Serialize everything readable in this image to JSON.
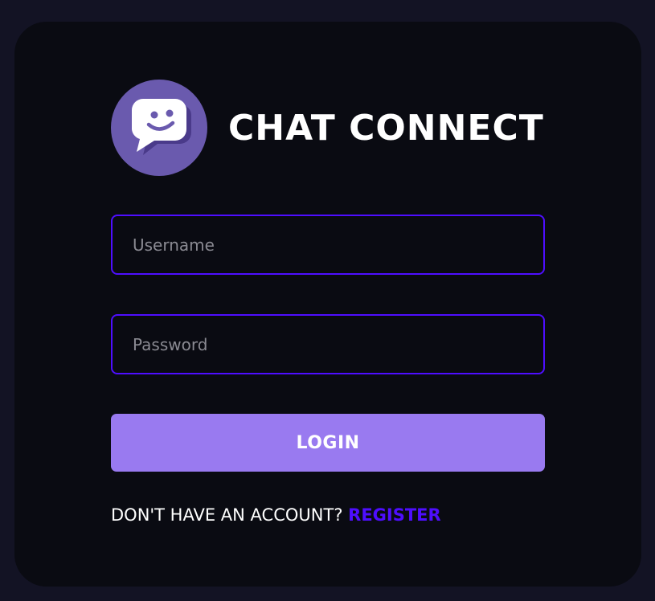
{
  "brand": {
    "title": "CHAT CONNECT",
    "logo_icon": "smiley-chat-bubble-icon",
    "logo_color": "#6a5aae"
  },
  "form": {
    "username_placeholder": "Username",
    "username_value": "",
    "password_placeholder": "Password",
    "password_value": "",
    "login_label": "LOGIN"
  },
  "footer": {
    "prompt": "DON'T HAVE AN ACCOUNT?",
    "register_label": "REGISTER"
  },
  "colors": {
    "page_background": "#131324",
    "card_background": "#0a0b12",
    "input_border": "#4e0eff",
    "button_background": "#997af0",
    "link_color": "#4e0eff"
  }
}
